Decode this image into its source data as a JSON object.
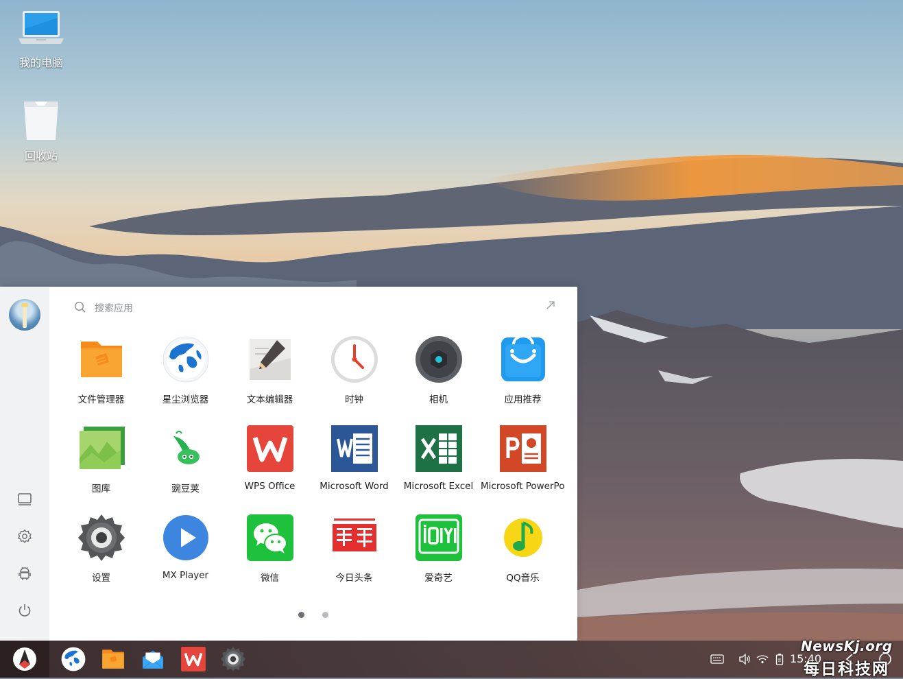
{
  "desktop": {
    "icons": [
      {
        "label": "我的电脑",
        "icon": "laptop-icon"
      },
      {
        "label": "回收站",
        "icon": "trash-icon"
      }
    ]
  },
  "start_menu": {
    "search": {
      "placeholder": "搜索应用"
    },
    "sidebar": [
      "avatar",
      "desktop-icon",
      "settings-icon",
      "android-icon",
      "power-icon"
    ],
    "apps": [
      {
        "label": "文件管理器",
        "icon": "folder-icon"
      },
      {
        "label": "星尘浏览器",
        "icon": "globe-browser-icon"
      },
      {
        "label": "文本编辑器",
        "icon": "pen-editor-icon"
      },
      {
        "label": "时钟",
        "icon": "clock-icon"
      },
      {
        "label": "相机",
        "icon": "camera-icon"
      },
      {
        "label": "应用推荐",
        "icon": "shopping-bag-icon"
      },
      {
        "label": "图库",
        "icon": "gallery-icon"
      },
      {
        "label": "豌豆荚",
        "icon": "pea-pod-icon"
      },
      {
        "label": "WPS Office",
        "icon": "wps-icon"
      },
      {
        "label": "Microsoft Word",
        "icon": "word-icon"
      },
      {
        "label": "Microsoft Excel",
        "icon": "excel-icon"
      },
      {
        "label": "Microsoft PowerPoint",
        "icon": "powerpoint-icon"
      },
      {
        "label": "设置",
        "icon": "gear-icon"
      },
      {
        "label": "MX Player",
        "icon": "play-icon"
      },
      {
        "label": "微信",
        "icon": "wechat-icon"
      },
      {
        "label": "今日头条",
        "icon": "toutiao-icon"
      },
      {
        "label": "爱奇艺",
        "icon": "iqiyi-icon"
      },
      {
        "label": "QQ音乐",
        "icon": "qq-music-icon"
      }
    ],
    "pages": {
      "current": 1,
      "total": 2
    }
  },
  "taskbar": {
    "pinned": [
      "globe-browser-icon",
      "folder-icon",
      "mail-icon",
      "wps-icon",
      "gear-icon"
    ],
    "tray": [
      "keyboard-icon",
      "volume-icon",
      "wifi-icon",
      "battery-icon"
    ],
    "clock": "15:40",
    "nav": [
      "back-icon",
      "home-icon"
    ]
  },
  "watermark": {
    "line1": "NewsKj.org",
    "line2": "每日科技网"
  },
  "colors": {
    "menu_bg": "#ffffff",
    "sidebar_bg": "#f1f2f4",
    "page_dot_active": "#6d7177",
    "page_dot_inactive": "#b8bcc2"
  }
}
